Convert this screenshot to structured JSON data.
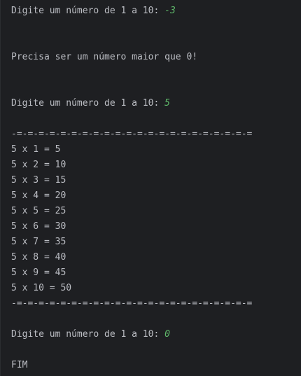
{
  "console": {
    "lines": [
      {
        "prompt": "Digite um número de 1 a 10: ",
        "input": "-3"
      },
      {
        "text": "Precisa ser um número maior que 0!"
      },
      {
        "prompt": "Digite um número de 1 a 10: ",
        "input": "5"
      },
      {
        "text": "-=-=-=-=-=-=-=-=-=-=-=-=-=-=-=-=-=-=-=-=-=-="
      },
      {
        "text": "5 x 1 = 5"
      },
      {
        "text": "5 x 2 = 10"
      },
      {
        "text": "5 x 3 = 15"
      },
      {
        "text": "5 x 4 = 20"
      },
      {
        "text": "5 x 5 = 25"
      },
      {
        "text": "5 x 6 = 30"
      },
      {
        "text": "5 x 7 = 35"
      },
      {
        "text": "5 x 8 = 40"
      },
      {
        "text": "5 x 9 = 45"
      },
      {
        "text": "5 x 10 = 50"
      },
      {
        "text": "-=-=-=-=-=-=-=-=-=-=-=-=-=-=-=-=-=-=-=-=-=-="
      },
      {
        "prompt": "Digite um número de 1 a 10: ",
        "input": "0"
      },
      {
        "text": "FIM"
      }
    ]
  },
  "colors": {
    "background": "#1e1f22",
    "text": "#bcbec4",
    "user_input": "#5fb86a"
  }
}
